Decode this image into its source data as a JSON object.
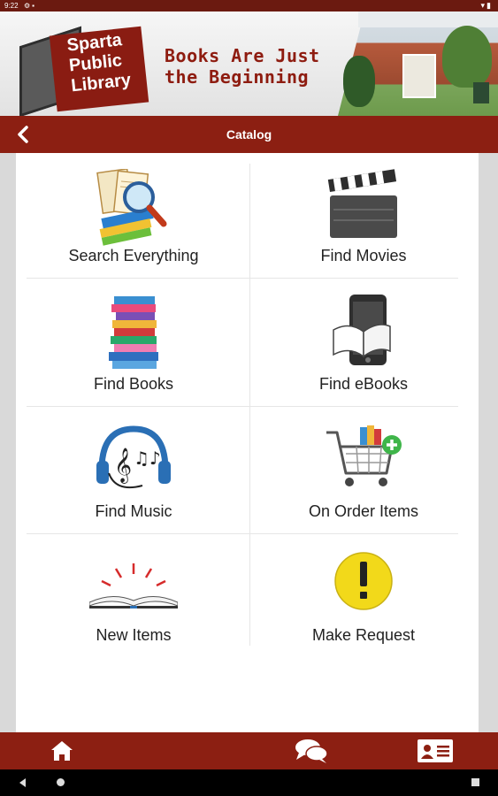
{
  "status_bar": {
    "time": "9:22",
    "left_icons": [
      "settings-icon",
      "lock-icon"
    ],
    "right_icons": [
      "wifi-icon",
      "battery-icon"
    ]
  },
  "banner": {
    "logo_lines": [
      "Sparta",
      "Public",
      "Library"
    ],
    "tagline_line1": "Books Are Just",
    "tagline_line2": "the Beginning"
  },
  "header": {
    "title": "Catalog",
    "back_icon": "chevron-left-icon"
  },
  "catalog_items": [
    {
      "label": "Search Everything",
      "icon": "search-books-icon"
    },
    {
      "label": "Find Movies",
      "icon": "clapperboard-icon"
    },
    {
      "label": "Find Books",
      "icon": "book-stack-icon"
    },
    {
      "label": "Find eBooks",
      "icon": "ebook-reader-icon"
    },
    {
      "label": "Find Music",
      "icon": "headphones-music-icon"
    },
    {
      "label": "On Order Items",
      "icon": "shopping-cart-add-icon"
    },
    {
      "label": "New Items",
      "icon": "open-book-burst-icon"
    },
    {
      "label": "Make Request",
      "icon": "exclamation-icon"
    }
  ],
  "bottom_nav": [
    "home-icon",
    "chat-icon",
    "library-card-icon"
  ],
  "colors": {
    "brand": "#8c1f12",
    "status_bar": "#6b1a10",
    "tagline": "#8e1c10"
  }
}
